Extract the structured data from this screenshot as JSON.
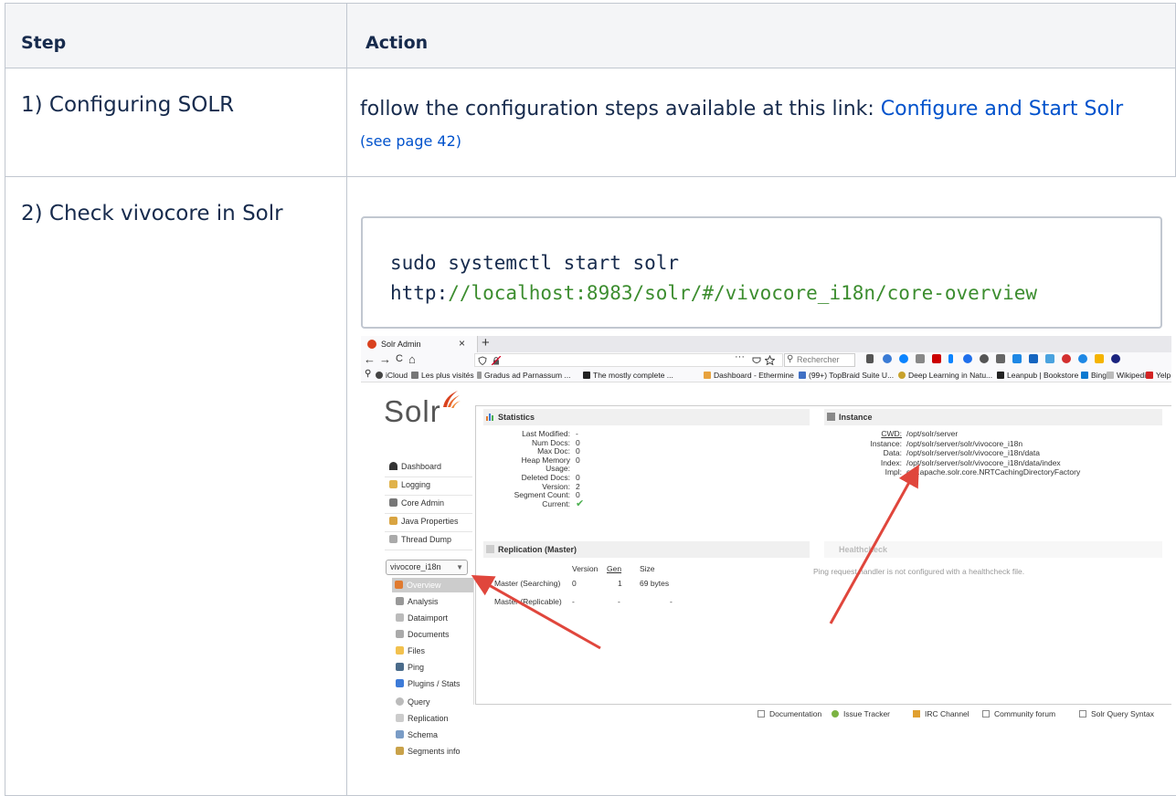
{
  "table": {
    "header_step": "Step",
    "header_action": "Action",
    "rows": [
      {
        "step": "1) Configuring SOLR",
        "action_prefix": "follow the configuration steps available at this link: ",
        "link_text": "Configure and Start Solr",
        "page_ref": "(see page 42)"
      },
      {
        "step": "2) Check vivocore in Solr",
        "code_line1": "sudo systemctl start solr",
        "code_line2_prefix": "http:",
        "code_line2_rest": "//localhost:8983/solr/#/vivocore_i18n/core-overview"
      }
    ]
  },
  "screenshot": {
    "tab_title": "Solr Admin",
    "tab_close": "×",
    "tab_new": "+",
    "nav": {
      "back": "←",
      "forward": "→",
      "reload": "C",
      "home": "⌂",
      "more": "···"
    },
    "search_placeholder": "Rechercher",
    "bookmarks": [
      "iCloud",
      "Les plus visités",
      "Gradus ad Parnassum ...",
      "The mostly complete ...",
      "Dashboard - Ethermine",
      "(99+) TopBraid Suite U...",
      "Deep Learning in Natu...",
      "Leanpub | Bookstore",
      "Bing",
      "Wikipedia",
      "Yelp"
    ],
    "logo": "Solr",
    "sidebar": [
      "Dashboard",
      "Logging",
      "Core Admin",
      "Java Properties",
      "Thread Dump"
    ],
    "core_selector": "vivocore_i18n",
    "core_nav": [
      "Overview",
      "Analysis",
      "Dataimport",
      "Documents",
      "Files",
      "Ping",
      "Plugins / Stats",
      "Query",
      "Replication",
      "Schema",
      "Segments info"
    ],
    "statistics": {
      "title": "Statistics",
      "rows": [
        {
          "k": "Last Modified:",
          "v": "-"
        },
        {
          "k": "Num Docs:",
          "v": "0"
        },
        {
          "k": "Max Doc:",
          "v": "0"
        },
        {
          "k": "Heap Memory",
          "v": "0"
        },
        {
          "k": "Usage:",
          "v": ""
        },
        {
          "k": "Deleted Docs:",
          "v": "0"
        },
        {
          "k": "Version:",
          "v": "2"
        },
        {
          "k": "Segment Count:",
          "v": "0"
        },
        {
          "k": "Current:",
          "v": "✔"
        }
      ]
    },
    "instance": {
      "title": "Instance",
      "rows": [
        {
          "k": "CWD:",
          "v": "/opt/solr/server"
        },
        {
          "k": "Instance:",
          "v": "/opt/solr/server/solr/vivocore_i18n"
        },
        {
          "k": "Data:",
          "v": "/opt/solr/server/solr/vivocore_i18n/data"
        },
        {
          "k": "Index:",
          "v": "/opt/solr/server/solr/vivocore_i18n/data/index"
        },
        {
          "k": "Impl:",
          "v": "org.apache.solr.core.NRTCachingDirectoryFactory"
        }
      ]
    },
    "replication": {
      "title": "Replication (Master)",
      "headers": [
        "Version",
        "Gen",
        "Size"
      ],
      "rows": [
        {
          "label": "Master (Searching)",
          "version": "0",
          "gen": "1",
          "size": "69 bytes"
        },
        {
          "label": "Master (Replicable)",
          "version": "-",
          "gen": "-",
          "size": "-"
        }
      ]
    },
    "healthcheck": {
      "title": "Healthcheck",
      "text": "Ping request handler is not configured with a healthcheck file."
    },
    "footer": [
      "Documentation",
      "Issue Tracker",
      "IRC Channel",
      "Community forum",
      "Solr Query Syntax"
    ],
    "colors": {
      "arrow": "#e0463c",
      "solr_orange": "#d9411e",
      "link": "#0052cc",
      "code_green": "#3c8d2f"
    }
  }
}
